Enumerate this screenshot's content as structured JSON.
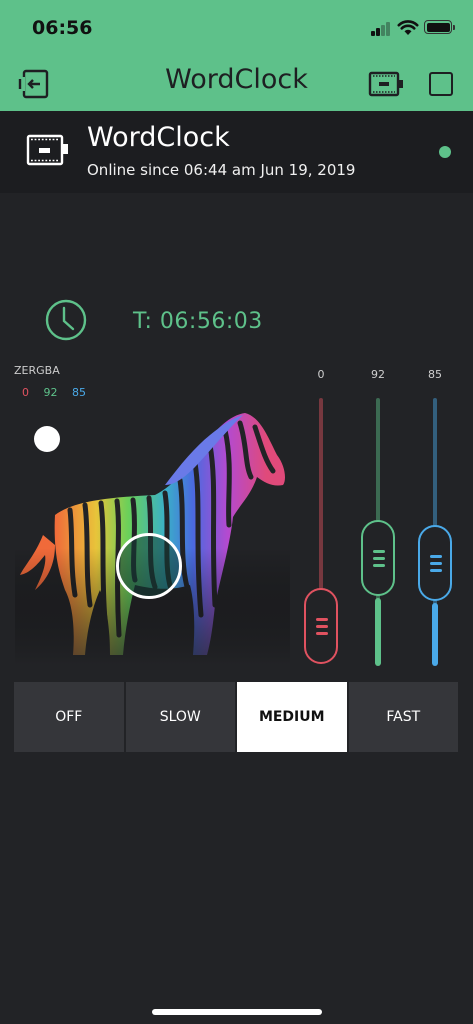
{
  "status_bar": {
    "time": "06:56"
  },
  "header": {
    "title": "WordClock",
    "icons": [
      "back-device-icon",
      "device-icon",
      "square-icon"
    ]
  },
  "device": {
    "name": "WordClock",
    "online_text": "Online since 06:44 am Jun 19, 2019",
    "status_color": "#5ec18a"
  },
  "clock": {
    "time_text": "T: 06:56:03"
  },
  "zergba": {
    "label": "ZERGBA",
    "r": "0",
    "g": "92",
    "b": "85"
  },
  "sliders": [
    {
      "value": "0",
      "level": 0.0,
      "color": "#e05260"
    },
    {
      "value": "92",
      "level": 0.36,
      "color": "#5ec18a"
    },
    {
      "value": "85",
      "level": 0.33,
      "color": "#4aa9e8"
    }
  ],
  "speed_modes": {
    "options": [
      "OFF",
      "SLOW",
      "MEDIUM",
      "FAST"
    ],
    "selected": "MEDIUM"
  },
  "colors": {
    "accent": "#5ec18a",
    "background": "#222326"
  }
}
